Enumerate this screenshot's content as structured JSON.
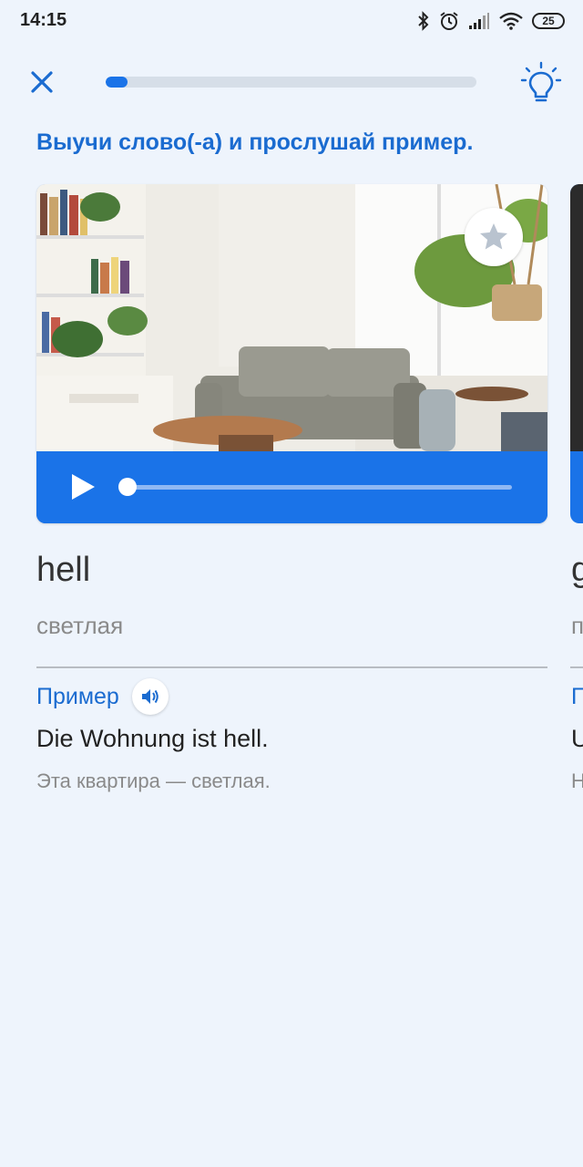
{
  "status_bar": {
    "time": "14:15",
    "battery": "25",
    "icons": [
      "bluetooth-icon",
      "alarm-icon",
      "signal-icon",
      "wifi-icon",
      "battery-icon"
    ]
  },
  "header": {
    "close_icon": "close-icon",
    "progress": 0.06,
    "hint_icon": "lightbulb-icon"
  },
  "instruction": "Выучи слово(-а) и прослушай пример.",
  "card": {
    "image_alt": "living room photo",
    "favorite_icon": "star-icon",
    "player": {
      "play_icon": "play-icon",
      "position": 0.0
    },
    "word": "hell",
    "translation": "светлая",
    "example_label": "Пример",
    "example_sound_icon": "speaker-icon",
    "example_sentence": "Die Wohnung ist hell.",
    "example_translation": "Эта квартира — светлая."
  },
  "next_card": {
    "word_peek": "g",
    "translation_peek": "п",
    "example_label_peek": "П",
    "example_sentence_peek": "U",
    "example_translation_peek": "Н"
  },
  "colors": {
    "accent": "#1a73e8",
    "background": "#eef4fc",
    "label_blue": "#1a6bd0"
  }
}
